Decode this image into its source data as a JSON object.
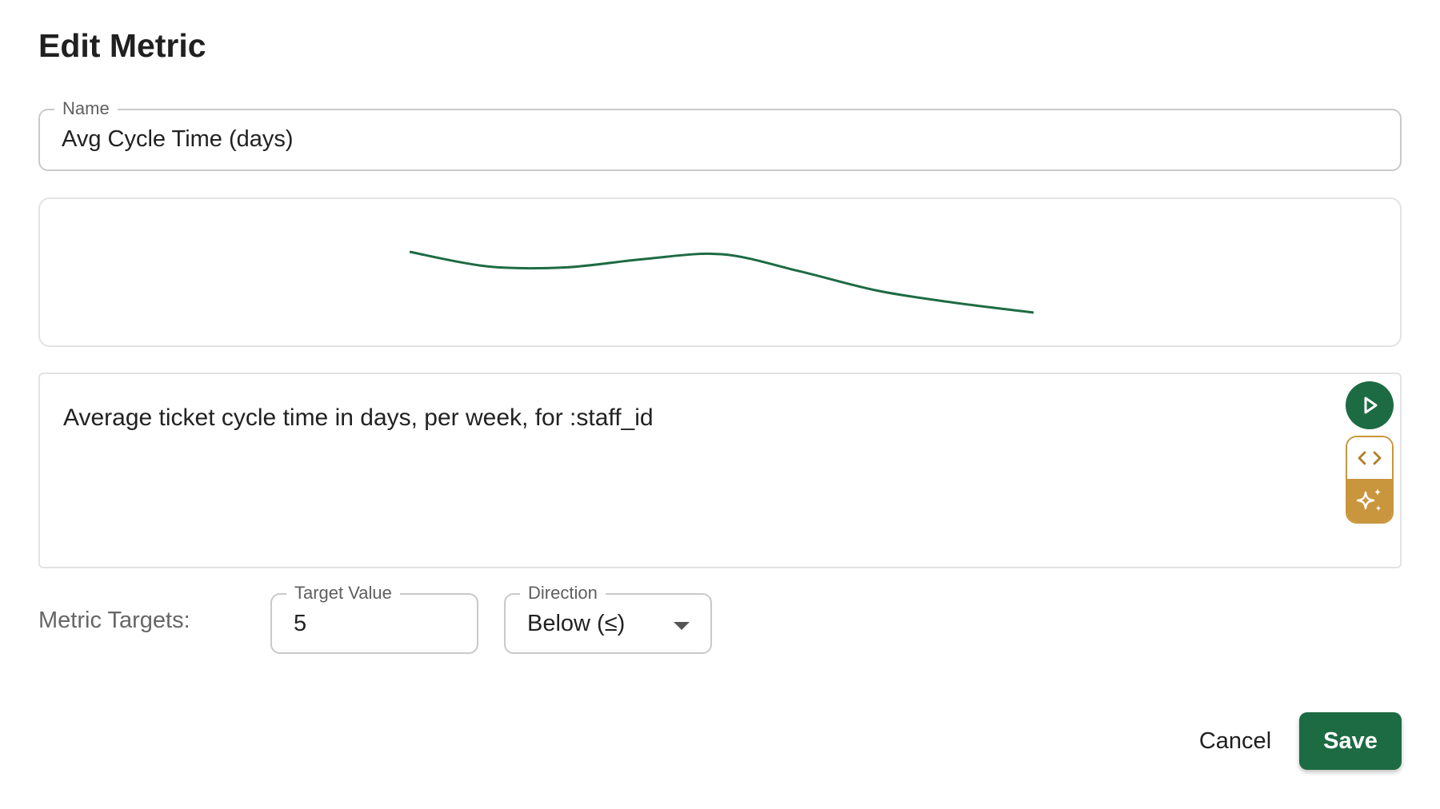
{
  "dialog": {
    "title": "Edit Metric"
  },
  "name_field": {
    "label": "Name",
    "value": "Avg Cycle Time (days)"
  },
  "preview": {
    "line_color": "#1d6b43",
    "values": [
      5.6,
      5.3,
      5.28,
      5.45,
      5.55,
      5.2,
      4.8,
      4.55,
      4.35
    ]
  },
  "query": {
    "text": "Average ticket cycle time in days, per week, for :staff_id",
    "run_icon": "play-icon",
    "code_icon": "code-icon",
    "ai_icon": "sparkles-icon"
  },
  "targets": {
    "label": "Metric Targets:",
    "target_value": {
      "label": "Target Value",
      "value": "5"
    },
    "direction": {
      "label": "Direction",
      "value": "Below (≤)",
      "icon": "chevron-down-icon"
    }
  },
  "actions": {
    "cancel_label": "Cancel",
    "save_label": "Save"
  },
  "colors": {
    "primary": "#1d6b43",
    "accent": "#c9963e"
  }
}
